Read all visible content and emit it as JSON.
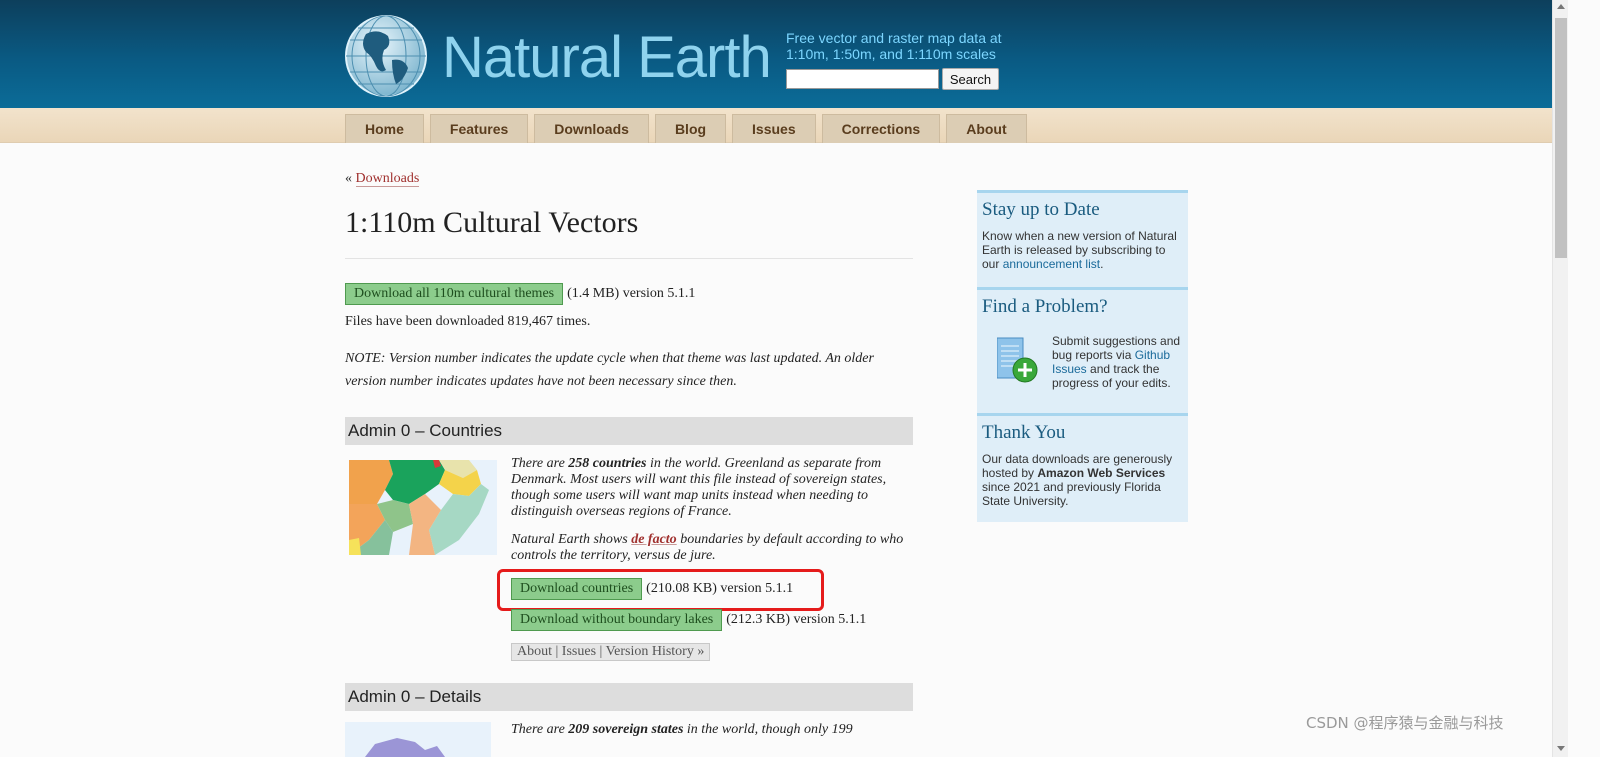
{
  "header": {
    "site_name": "Natural Earth",
    "tagline": "Free vector and raster map data at 1:10m, 1:50m, and 1:110m scales",
    "search_placeholder": "",
    "search_button": "Search",
    "logo_icon": "globe-icon"
  },
  "nav": {
    "items": [
      "Home",
      "Features",
      "Downloads",
      "Blog",
      "Issues",
      "Corrections",
      "About"
    ]
  },
  "breadcrumb": {
    "prefix": "«",
    "link": "Downloads"
  },
  "page": {
    "title": "1:110m Cultural Vectors",
    "download_all": {
      "label": "Download all 110m cultural themes",
      "meta": "(1.4 MB) version 5.1.1"
    },
    "downloads_count": "Files have been downloaded 819,467 times.",
    "note": "NOTE: Version number indicates the update cycle when that theme was last updated. An older version number indicates updates have not been necessary since then."
  },
  "sections": [
    {
      "title": "Admin 0 – Countries",
      "desc1_pre": "There are ",
      "desc1_bold": "258 countries",
      "desc1_post": " in the world. Greenland as separate from Denmark. Most users will want this file instead of sovereign states, though some users will want map units instead when needing to distinguish overseas regions of France.",
      "desc2_pre": "Natural Earth shows ",
      "desc2_link": "de facto",
      "desc2_post": " boundaries by default according to who controls the territory, versus de jure.",
      "download1": {
        "label": "Download countries",
        "meta": "(210.08 KB) version 5.1.1"
      },
      "download2": {
        "label": "Download without boundary lakes",
        "meta": "(212.3 KB) version 5.1.1"
      },
      "links": "About | Issues | Version History »"
    },
    {
      "title": "Admin 0 – Details",
      "desc_pre": "There are ",
      "desc_bold": "209 sovereign states",
      "desc_post": " in the world, though only 199"
    }
  ],
  "sidebar": {
    "stay": {
      "title": "Stay up to Date",
      "text": "Know when a new version of Natural Earth is released by subscribing to our ",
      "link": "announcement list",
      "text_end": "."
    },
    "problem": {
      "title": "Find a Problem?",
      "text_pre": "Submit suggestions and bug reports via ",
      "link": "Github Issues",
      "text_post": " and track the progress of your edits.",
      "icon": "add-document-icon"
    },
    "thanks": {
      "title": "Thank You",
      "text_pre": "Our data downloads are generously hosted by ",
      "bold": "Amazon Web Services",
      "text_post": " since 2021 and previously Florida State University."
    }
  },
  "watermark": "CSDN @程序猿与金融与科技",
  "colors": {
    "header": "#0a5a83",
    "nav": "#ead6b8",
    "download_button": "#8ccc8c",
    "highlight": "#e51b1b",
    "link": "#a0302e"
  }
}
